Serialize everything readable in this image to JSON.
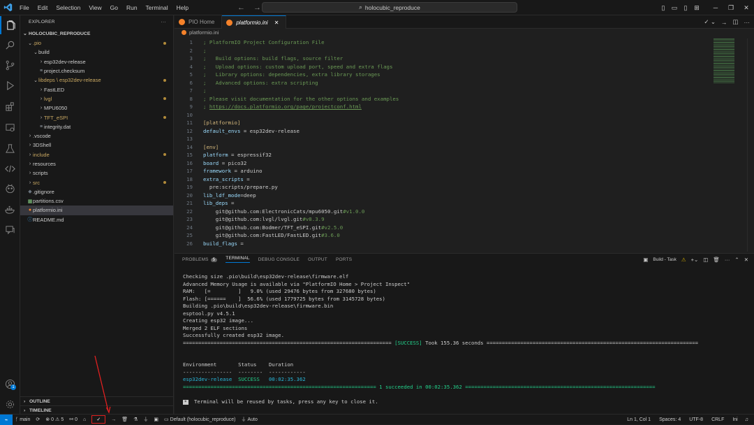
{
  "titlebar": {
    "menu": [
      "File",
      "Edit",
      "Selection",
      "View",
      "Go",
      "Run",
      "Terminal",
      "Help"
    ],
    "search": "holocubic_reproduce"
  },
  "sidebar": {
    "header": "EXPLORER",
    "more": "···",
    "root": "HOLOCUBIC_REPRODUCE",
    "items": [
      {
        "label": ".pio",
        "depth": 0,
        "type": "folder-open",
        "modified": true
      },
      {
        "label": "build",
        "depth": 1,
        "type": "folder-open",
        "modified": false
      },
      {
        "label": "esp32dev-release",
        "depth": 2,
        "type": "folder",
        "modified": false
      },
      {
        "label": "project.checksum",
        "depth": 2,
        "type": "file",
        "modified": false
      },
      {
        "label": "libdeps \\ esp32dev-release",
        "depth": 1,
        "type": "folder-open",
        "modified": true
      },
      {
        "label": "FastLED",
        "depth": 2,
        "type": "folder",
        "modified": false
      },
      {
        "label": "lvgl",
        "depth": 2,
        "type": "folder",
        "modified": true
      },
      {
        "label": "MPU6050",
        "depth": 2,
        "type": "folder",
        "modified": false
      },
      {
        "label": "TFT_eSPI",
        "depth": 2,
        "type": "folder",
        "modified": true
      },
      {
        "label": "integrity.dat",
        "depth": 2,
        "type": "file",
        "modified": false
      },
      {
        "label": ".vscode",
        "depth": 0,
        "type": "folder",
        "modified": false
      },
      {
        "label": "3DShell",
        "depth": 0,
        "type": "folder",
        "modified": false
      },
      {
        "label": "include",
        "depth": 0,
        "type": "folder",
        "modified": true
      },
      {
        "label": "resources",
        "depth": 0,
        "type": "folder",
        "modified": false
      },
      {
        "label": "scripts",
        "depth": 0,
        "type": "folder",
        "modified": false
      },
      {
        "label": "src",
        "depth": 0,
        "type": "folder",
        "modified": true
      },
      {
        "label": ".gitignore",
        "depth": 0,
        "type": "gitignore",
        "modified": false
      },
      {
        "label": "partitions.csv",
        "depth": 0,
        "type": "csv",
        "modified": false
      },
      {
        "label": "platformio.ini",
        "depth": 0,
        "type": "pio",
        "modified": false,
        "selected": true
      },
      {
        "label": "README.md",
        "depth": 0,
        "type": "info",
        "modified": false
      }
    ],
    "outline": "OUTLINE",
    "timeline": "TIMELINE"
  },
  "editor": {
    "tabs": [
      {
        "label": "PIO Home",
        "active": false
      },
      {
        "label": "platformio.ini",
        "active": true
      }
    ],
    "breadcrumb": "platformio.ini",
    "lines": [
      {
        "n": "1",
        "parts": [
          [
            "cm",
            "; PlatformIO Project Configuration File"
          ]
        ]
      },
      {
        "n": "2",
        "parts": [
          [
            "cm",
            ";"
          ]
        ]
      },
      {
        "n": "3",
        "parts": [
          [
            "cm",
            ";   Build options: build flags, source filter"
          ]
        ]
      },
      {
        "n": "4",
        "parts": [
          [
            "cm",
            ";   Upload options: custom upload port, speed and extra flags"
          ]
        ]
      },
      {
        "n": "5",
        "parts": [
          [
            "cm",
            ";   Library options: dependencies, extra library storages"
          ]
        ]
      },
      {
        "n": "6",
        "parts": [
          [
            "cm",
            ";   Advanced options: extra scripting"
          ]
        ]
      },
      {
        "n": "7",
        "parts": [
          [
            "cm",
            ";"
          ]
        ]
      },
      {
        "n": "8",
        "parts": [
          [
            "cm",
            "; Please visit documentation for the other options and examples"
          ]
        ]
      },
      {
        "n": "9",
        "parts": [
          [
            "cm",
            "; "
          ],
          [
            "url",
            "https://docs.platformio.org/page/projectconf.html"
          ]
        ]
      },
      {
        "n": "10",
        "parts": []
      },
      {
        "n": "11",
        "parts": [
          [
            "sec",
            "[platformio]"
          ]
        ]
      },
      {
        "n": "12",
        "parts": [
          [
            "key",
            "default_envs"
          ],
          [
            "pl",
            " = esp32dev-release"
          ]
        ]
      },
      {
        "n": "13",
        "parts": []
      },
      {
        "n": "14",
        "parts": [
          [
            "sec",
            "[env]"
          ]
        ]
      },
      {
        "n": "15",
        "parts": [
          [
            "key",
            "platform"
          ],
          [
            "pl",
            " = espressif32"
          ]
        ]
      },
      {
        "n": "16",
        "parts": [
          [
            "key",
            "board"
          ],
          [
            "pl",
            " = pico32"
          ]
        ]
      },
      {
        "n": "17",
        "parts": [
          [
            "key",
            "framework"
          ],
          [
            "pl",
            " = arduino"
          ]
        ]
      },
      {
        "n": "18",
        "parts": [
          [
            "key",
            "extra_scripts"
          ],
          [
            "pl",
            " ="
          ]
        ]
      },
      {
        "n": "19",
        "parts": [
          [
            "pl",
            "  pre:scripts/prepare.py"
          ]
        ]
      },
      {
        "n": "20",
        "parts": [
          [
            "key",
            "lib_ldf_mode"
          ],
          [
            "pl",
            "=deep"
          ]
        ]
      },
      {
        "n": "21",
        "parts": [
          [
            "key",
            "lib_deps"
          ],
          [
            "pl",
            " ="
          ]
        ]
      },
      {
        "n": "22",
        "parts": [
          [
            "pl",
            "    git@github.com:ElectronicCats/mpu6050.git"
          ],
          [
            "ver",
            "#v1.0.0"
          ]
        ]
      },
      {
        "n": "23",
        "parts": [
          [
            "pl",
            "    git@github.com:lvgl/lvgl.git"
          ],
          [
            "ver",
            "#v8.3.9"
          ]
        ]
      },
      {
        "n": "24",
        "parts": [
          [
            "pl",
            "    git@github.com:Bodmer/TFT_eSPI.git"
          ],
          [
            "ver",
            "#v2.5.0"
          ]
        ]
      },
      {
        "n": "25",
        "parts": [
          [
            "pl",
            "    git@github.com:FastLED/FastLED.git"
          ],
          [
            "ver",
            "#3.6.0"
          ]
        ]
      },
      {
        "n": "26",
        "parts": [
          [
            "key",
            "build_flags"
          ],
          [
            "pl",
            " ="
          ]
        ]
      }
    ]
  },
  "panel": {
    "tabs": [
      "PROBLEMS",
      "TERMINAL",
      "DEBUG CONSOLE",
      "OUTPUT",
      "PORTS"
    ],
    "problems_count": "5",
    "task": "Build - Task",
    "terminal": [
      {
        "t": "Checking size .pio\\build\\esp32dev-release\\firmware.elf"
      },
      {
        "t": "Advanced Memory Usage is available via \"PlatformIO Home > Project Inspect\""
      },
      {
        "t": "RAM:   [=         ]   9.0% (used 29476 bytes from 327680 bytes)"
      },
      {
        "t": "Flash: [======    ]  56.6% (used 1779725 bytes from 3145728 bytes)"
      },
      {
        "t": "Building .pio\\build\\esp32dev-release\\firmware.bin"
      },
      {
        "t": "esptool.py v4.5.1"
      },
      {
        "t": "Creating esp32 image..."
      },
      {
        "t": "Merged 2 ELF sections"
      },
      {
        "t": "Successfully created esp32 image."
      },
      {
        "pre": "==================================================================== ",
        "mid": "[SUCCESS]",
        "post": " Took 155.36 seconds ====================================================================="
      },
      {
        "t": ""
      },
      {
        "t": ""
      },
      {
        "t": "Environment       Status    Duration"
      },
      {
        "t": "----------------  --------  ------------"
      },
      {
        "c1": "esp32dev-release",
        "c2": "  SUCCESS",
        "c3": "   00:02:35.362"
      },
      {
        "pre2": "=============================================================== ",
        "mid2": "1 succeeded in 00:02:35.362",
        "post2": " =============================================================="
      },
      {
        "t": ""
      },
      {
        "key": "*",
        "t2": " Terminal will be reused by tasks, press any key to close it."
      }
    ]
  },
  "statusbar": {
    "branch": "main",
    "errors": "0",
    "warnings": "5",
    "ports": "0",
    "env": "Default (holocubic_reproduce)",
    "auto": "Auto",
    "position": "Ln 1, Col 1",
    "spaces": "Spaces: 4",
    "encoding": "UTF-8",
    "eol": "CRLF",
    "lang": "Ini"
  }
}
